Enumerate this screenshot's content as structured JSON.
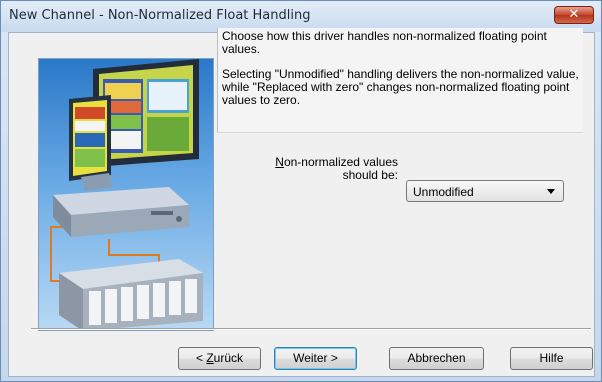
{
  "window": {
    "title": "New Channel - Non-Normalized Float Handling",
    "close_glyph": "✕"
  },
  "description": {
    "paragraph1": "Choose how this driver handles non-normalized floating point values.",
    "paragraph2": "Selecting \"Unmodified\" handling delivers the non-normalized value, while \"Replaced with zero\" changes non-normalized floating point values to zero."
  },
  "field": {
    "label_access_key": "N",
    "label_rest": "on-normalized values",
    "label_line2": "should be:",
    "selected_value": "Unmodified"
  },
  "buttons": {
    "back_prefix": "< ",
    "back_key": "Z",
    "back_rest": "urück",
    "next": "Weiter >",
    "cancel": "Abbrechen",
    "help": "Hilfe"
  },
  "illustration": {
    "icon": "pc-and-plc-network-illustration"
  },
  "colors": {
    "close_button": "#c4452d",
    "illustration_background": "#2a78c8",
    "default_button_border": "#3c7fb1"
  }
}
